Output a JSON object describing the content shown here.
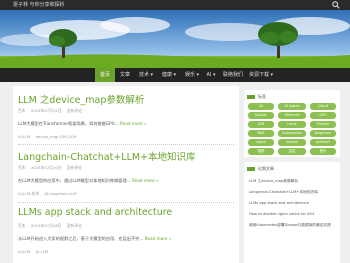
{
  "site": {
    "title": "逐子林 与你分享和探析"
  },
  "nav": {
    "items": [
      "首页",
      "文章",
      "技术 ▾",
      "健康 ▾",
      "娱乐 ▾",
      "AI ▾",
      "联络我们",
      "资源下载 ▾"
    ]
  },
  "posts": [
    {
      "title": "LLM 之device_map参数解析",
      "author": "百木",
      "date": "2024年07月12日",
      "comments": "没有评论",
      "excerpt": "LLM大模型在Transformer框架场景，如何根据GPU...",
      "more": "Read more »",
      "tags": "device_map,GPU,LLM",
      "category": "AI,LLM"
    },
    {
      "title": "Langchain-Chatchat+LLM+本地知识库",
      "author": "百木",
      "date": "2024年07月10日",
      "comments": "没有评论",
      "excerpt": "在LLM大模型的应用中，通过LLM模型对本地知识库做管理...",
      "more": "Read more »",
      "tags": "AI,langchain,LLM",
      "category": "AI,LLM,技术"
    },
    {
      "title": "LLMs app stack and architecture",
      "author": "百木",
      "date": "2024年07月08日",
      "comments": "没有评论",
      "excerpt": "从LLM开始进入大家的视野之后，基于大模型的应用、也层出不穷...",
      "more": "Read more »",
      "tags": "AI,LLM",
      "category": "AI,LLM"
    }
  ],
  "sidebar": {
    "tags_title": "标签",
    "tags": [
      "AI",
      "AI Agent",
      "Cloud",
      "Docker",
      "Ethernet",
      "GPU",
      "LLM",
      "Linux",
      "Python",
      "RAG",
      "kubernetes",
      "langchain",
      "nginx",
      "openai",
      "python3",
      "视频",
      "监控",
      "音乐"
    ],
    "recent_title": "近期文章",
    "recent": [
      "LLM 之device_map参数解析",
      "Langchain-Chatchat+LLM+本地知识库",
      "LLMs app stack and architecture",
      "How to disable nginx cache for 404",
      "使用Kubernetes部署Django与数据库的最佳实践"
    ]
  },
  "colors": {
    "accent": "#6aa32b",
    "nav_bg": "#232323",
    "tag_bg": "#8cc152"
  }
}
